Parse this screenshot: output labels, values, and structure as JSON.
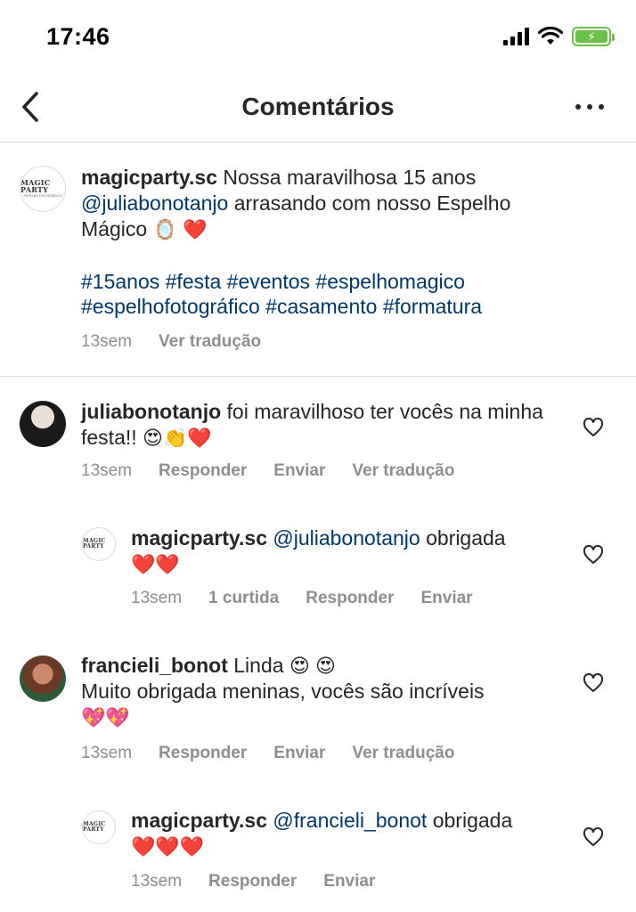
{
  "status_bar": {
    "time": "17:46",
    "battery_glyph": "⚡"
  },
  "header": {
    "title": "Comentários",
    "back_icon": "chevron-left-icon",
    "more_icon": "more-horizontal-icon"
  },
  "caption": {
    "avatar_logo": "MAGIC PARTY",
    "avatar_logo_sub": "ESPELHO FOTOGRÁFICO",
    "username": "magicparty.sc",
    "text_1": " Nossa maravilhosa 15 anos ",
    "mention": "@juliabonotanjo",
    "text_2": " arrasando com nosso Espelho Mágico ",
    "emojis": "🪞 ❤️",
    "hashtags_line1": "#15anos #festa #eventos #espelhomagico",
    "hashtags_line2": "#espelhofotográfico #casamento #formatura",
    "time": "13sem",
    "translate": "Ver tradução"
  },
  "comments": [
    {
      "username": "juliabonotanjo",
      "text": " foi maravilhoso ter vocês na minha festa!! ",
      "emojis": "😍👏❤️",
      "time": "13sem",
      "reply": "Responder",
      "send": "Enviar",
      "translate": "Ver tradução"
    },
    {
      "username": "magicparty.sc",
      "mention": "@juliabonotanjo",
      "text": " obrigada",
      "emojis": "❤️❤️",
      "time": "13sem",
      "likes": "1 curtida",
      "reply": "Responder",
      "send": "Enviar"
    },
    {
      "username": "francieli_bonot",
      "text_1": " Linda ",
      "emojis_1": "😍 😍",
      "text_2": "Muito obrigada meninas, vocês são incríveis",
      "emojis_2": "💖💖",
      "time": "13sem",
      "reply": "Responder",
      "send": "Enviar",
      "translate": "Ver tradução"
    },
    {
      "username": "magicparty.sc",
      "mention": "@francieli_bonot",
      "text": " obrigada",
      "emojis": "❤️❤️❤️",
      "time": "13sem",
      "reply": "Responder",
      "send": "Enviar"
    }
  ],
  "colors": {
    "text": "#262626",
    "muted": "#8e8e8e",
    "link": "#00376b",
    "divider": "#dbdbdb",
    "battery": "#6cc04a"
  }
}
